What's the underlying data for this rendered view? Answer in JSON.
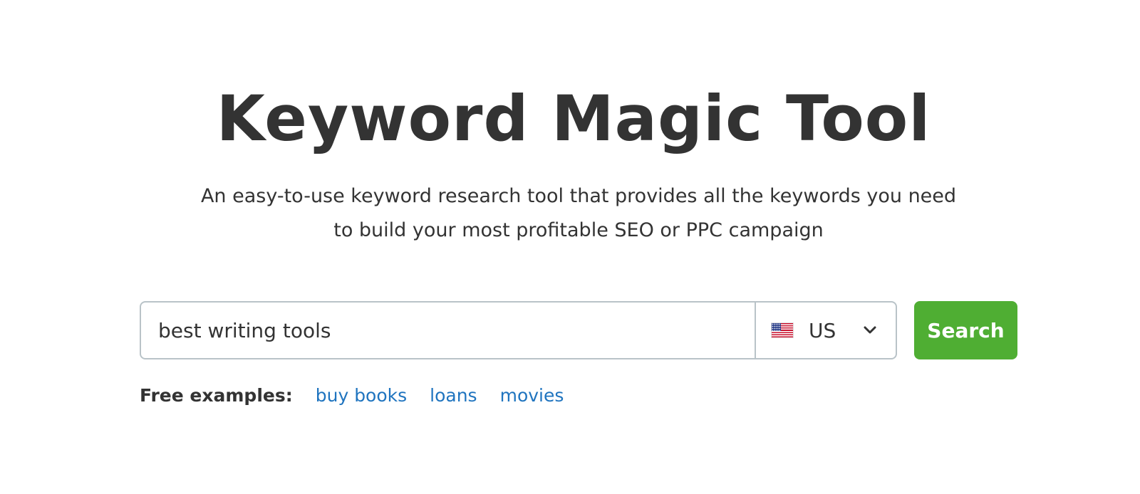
{
  "header": {
    "title": "Keyword Magic Tool",
    "subtitle_line1": "An easy-to-use keyword research tool that provides all the keywords you need",
    "subtitle_line2": "to build your most profitable SEO or PPC campaign"
  },
  "search": {
    "value": "best writing tools",
    "database": {
      "flag_icon": "us-flag-icon",
      "selected": "US"
    },
    "button_label": "Search"
  },
  "examples": {
    "label": "Free examples:",
    "links": [
      "buy books",
      "loans",
      "movies"
    ]
  },
  "colors": {
    "title_text": "#333333",
    "button_bg": "#4fae33",
    "link": "#1f74bf",
    "input_border": "#b9c3c8"
  }
}
